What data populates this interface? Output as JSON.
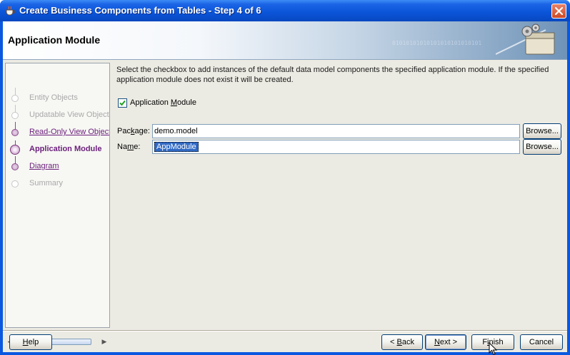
{
  "window": {
    "title": "Create Business Components from Tables - Step 4 of 6",
    "title_icon": "coffee-cup-icon",
    "close_icon": "close-icon",
    "accent_color": "#0a58e0"
  },
  "banner": {
    "title": "Application Module",
    "binary_text": "01010101010101010101010101",
    "art_icon": "gears-folder-icon"
  },
  "steps": [
    {
      "label": "Entity Objects",
      "state": "disabled"
    },
    {
      "label": "Updatable View Objects",
      "state": "disabled"
    },
    {
      "label": "Read-Only View Objects",
      "state": "link"
    },
    {
      "label": "Application Module",
      "state": "current"
    },
    {
      "label": "Diagram",
      "state": "link"
    },
    {
      "label": "Summary",
      "state": "disabled"
    }
  ],
  "content": {
    "description": "Select the checkbox to add instances of the default data model components the specified application module.  If the specified application module does not exist it will be created.",
    "checkbox": {
      "label_pre": "Application ",
      "label_mn": "M",
      "label_post": "odule",
      "checked": true
    },
    "package": {
      "label_pre": "Pac",
      "label_mn": "k",
      "label_post": "age:",
      "value": "demo.model",
      "browse": "Browse..."
    },
    "name": {
      "label_pre": "Na",
      "label_mn": "m",
      "label_post": "e:",
      "value": "AppModule",
      "browse": "Browse..."
    }
  },
  "footer": {
    "help": {
      "mn": "H",
      "rest": "elp"
    },
    "back": {
      "pre": "< ",
      "mn": "B",
      "rest": "ack"
    },
    "next": {
      "mn": "N",
      "rest": "ext >"
    },
    "finish": {
      "pre": "F",
      "mn": "i",
      "rest": "nish"
    },
    "cancel": "Cancel"
  }
}
